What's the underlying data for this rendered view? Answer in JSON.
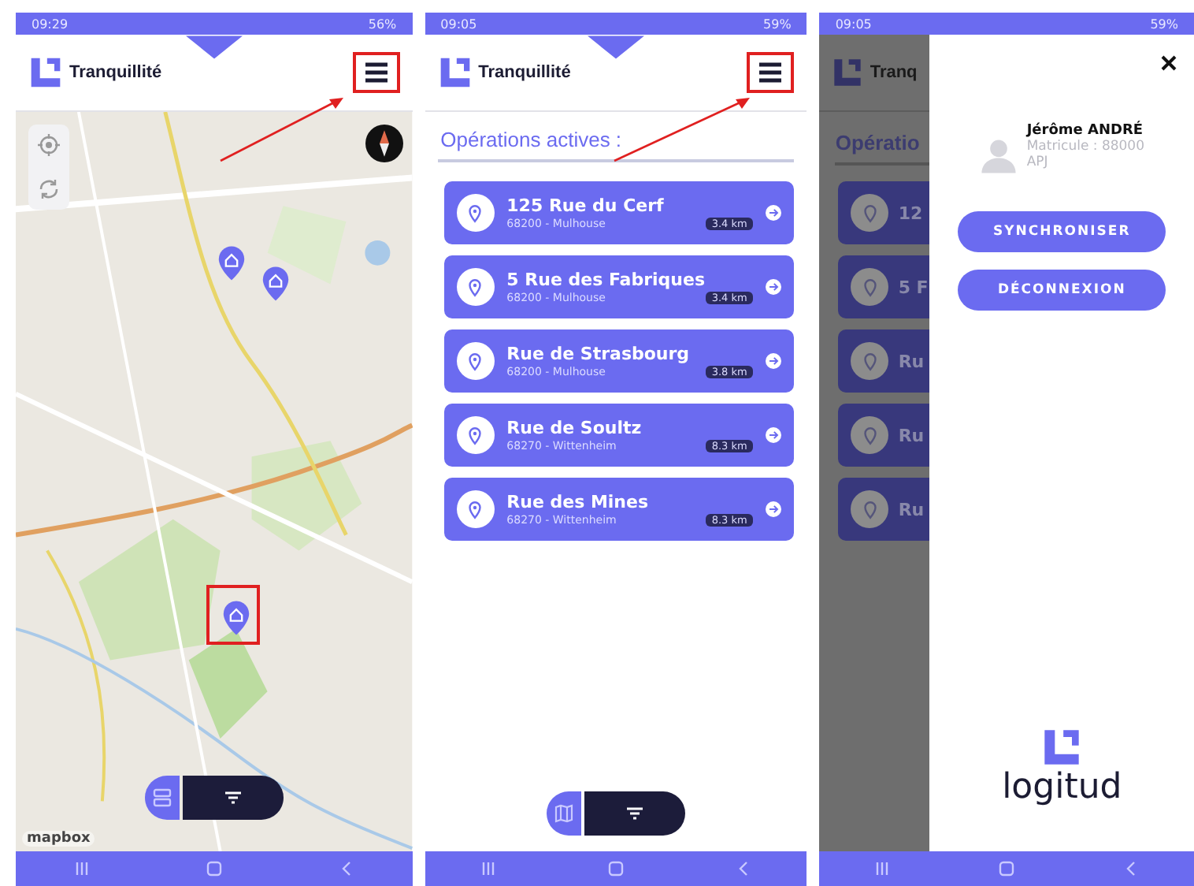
{
  "map_screen": {
    "status_bar": {
      "time": "09:29",
      "battery": "56%"
    },
    "app_title": "Tranquillité",
    "attribution": "mapbox"
  },
  "list_screen": {
    "status_bar": {
      "time": "09:05",
      "battery": "59%"
    },
    "app_title": "Tranquillité",
    "heading": "Opérations actives :",
    "operations": [
      {
        "street": "125 Rue du Cerf",
        "city": "68200 - Mulhouse",
        "distance": "3.4 km"
      },
      {
        "street": "5 Rue des Fabriques",
        "city": "68200 - Mulhouse",
        "distance": "3.4 km"
      },
      {
        "street": "Rue de Strasbourg",
        "city": "68200 - Mulhouse",
        "distance": "3.8 km"
      },
      {
        "street": "Rue de Soultz",
        "city": "68270 - Wittenheim",
        "distance": "8.3 km"
      },
      {
        "street": "Rue des Mines",
        "city": "68270 - Wittenheim",
        "distance": "8.3 km"
      }
    ]
  },
  "menu_screen": {
    "status_bar": {
      "time": "09:05",
      "battery": "59%"
    },
    "background": {
      "app_title": "Tranq",
      "heading": "Opératio",
      "cards": [
        "12",
        "5 F",
        "Ru",
        "Ru",
        "Ru"
      ]
    },
    "user": {
      "name": "Jérôme ANDRÉ",
      "matricule": "Matricule : 88000",
      "role": "APJ"
    },
    "buttons": [
      "SYNCHRONISER",
      "DÉCONNEXION"
    ],
    "brand": "logitud"
  }
}
